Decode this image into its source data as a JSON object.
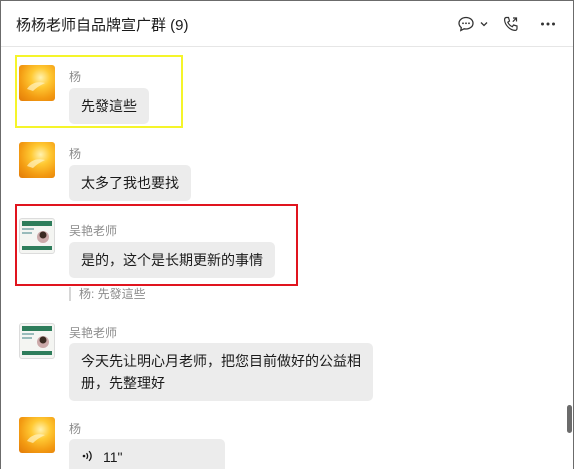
{
  "header": {
    "title": "杨杨老师自品牌宣广群 (9)",
    "icons": [
      "chat-bubble-icon",
      "chevron-down-icon",
      "phone-call-icon",
      "more-icon"
    ]
  },
  "messages": [
    {
      "sender": "杨",
      "text": "先發這些",
      "avatar": "yang"
    },
    {
      "sender": "杨",
      "text": "太多了我也要找",
      "avatar": "yang"
    },
    {
      "sender": "吴艳老师",
      "text": "是的，这个是长期更新的事情",
      "avatar": "wu",
      "quote": "杨: 先發這些"
    },
    {
      "sender": "吴艳老师",
      "text_line1": "今天先让明心月老师，把您目前做好的公益相",
      "text_line2": "册，先整理好",
      "avatar": "wu"
    },
    {
      "sender": "杨",
      "voice_duration": "11\"",
      "avatar": "yang"
    }
  ],
  "colors": {
    "highlight_yellow": "#f5f52a",
    "highlight_red": "#e0141e",
    "bubble": "#ececec"
  }
}
